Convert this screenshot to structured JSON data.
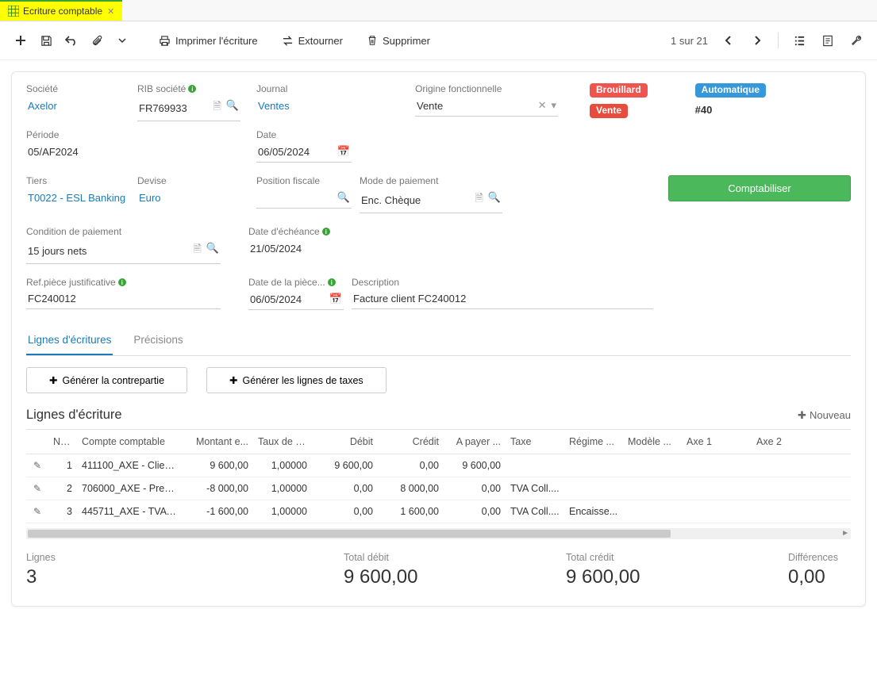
{
  "tab": {
    "title": "Ecriture comptable"
  },
  "toolbar": {
    "print": "Imprimer l'écriture",
    "reverse": "Extourner",
    "delete": "Supprimer",
    "pager": "1 sur 21"
  },
  "form": {
    "company": {
      "label": "Société",
      "value": "Axelor"
    },
    "rib": {
      "label": "RIB société",
      "value": "FR769933"
    },
    "journal": {
      "label": "Journal",
      "value": "Ventes"
    },
    "origin": {
      "label": "Origine fonctionnelle",
      "value": "Vente"
    },
    "period": {
      "label": "Période",
      "value": "05/AF2024"
    },
    "date": {
      "label": "Date",
      "value": "06/05/2024"
    },
    "partner": {
      "label": "Tiers",
      "value": "T0022 - ESL Banking"
    },
    "currency": {
      "label": "Devise",
      "value": "Euro"
    },
    "fiscal_position": {
      "label": "Position fiscale",
      "value": ""
    },
    "payment_mode": {
      "label": "Mode de paiement",
      "value": "Enc. Chèque"
    },
    "payment_condition": {
      "label": "Condition de paiement",
      "value": "15 jours nets"
    },
    "due_date": {
      "label": "Date d'échéance",
      "value": "21/05/2024"
    },
    "ref": {
      "label": "Ref.pièce justificative",
      "value": "FC240012"
    },
    "piece_date": {
      "label": "Date de la pièce...",
      "value": "06/05/2024"
    },
    "description": {
      "label": "Description",
      "value": "Facture client FC240012"
    }
  },
  "badges": {
    "draft": "Brouillard",
    "sale": "Vente",
    "auto": "Automatique",
    "ref": "#40"
  },
  "actions": {
    "validate": "Comptabiliser",
    "generate_counter": "Générer la contrepartie",
    "generate_tax": "Générer les lignes de taxes",
    "new": "Nouveau"
  },
  "tabs": {
    "lines": "Lignes d'écritures",
    "details": "Précisions"
  },
  "lines": {
    "title": "Lignes d'écriture",
    "headers": {
      "num": "N° ...",
      "account": "Compte comptable",
      "amount": "Montant e...",
      "rate": "Taux de c...",
      "debit": "Débit",
      "credit": "Crédit",
      "topay": "A payer ...",
      "tax": "Taxe",
      "regime": "Régime ...",
      "model": "Modèle ...",
      "axis1": "Axe 1",
      "axis2": "Axe 2"
    },
    "rows": [
      {
        "n": "1",
        "account": "411100_AXE - Client...",
        "amount": "9 600,00",
        "rate": "1,00000",
        "debit": "9 600,00",
        "credit": "0,00",
        "topay": "9 600,00",
        "tax": "",
        "regime": ""
      },
      {
        "n": "2",
        "account": "706000_AXE - Presta...",
        "amount": "-8 000,00",
        "rate": "1,00000",
        "debit": "0,00",
        "credit": "8 000,00",
        "topay": "0,00",
        "tax": "TVA Coll....",
        "regime": ""
      },
      {
        "n": "3",
        "account": "445711_AXE - TVA N ...",
        "amount": "-1 600,00",
        "rate": "1,00000",
        "debit": "0,00",
        "credit": "1 600,00",
        "topay": "0,00",
        "tax": "TVA Coll....",
        "regime": "Encaisse..."
      }
    ]
  },
  "totals": {
    "lines_label": "Lignes",
    "lines": "3",
    "debit_label": "Total débit",
    "debit": "9 600,00",
    "credit_label": "Total crédit",
    "credit": "9 600,00",
    "diff_label": "Différences",
    "diff": "0,00"
  }
}
